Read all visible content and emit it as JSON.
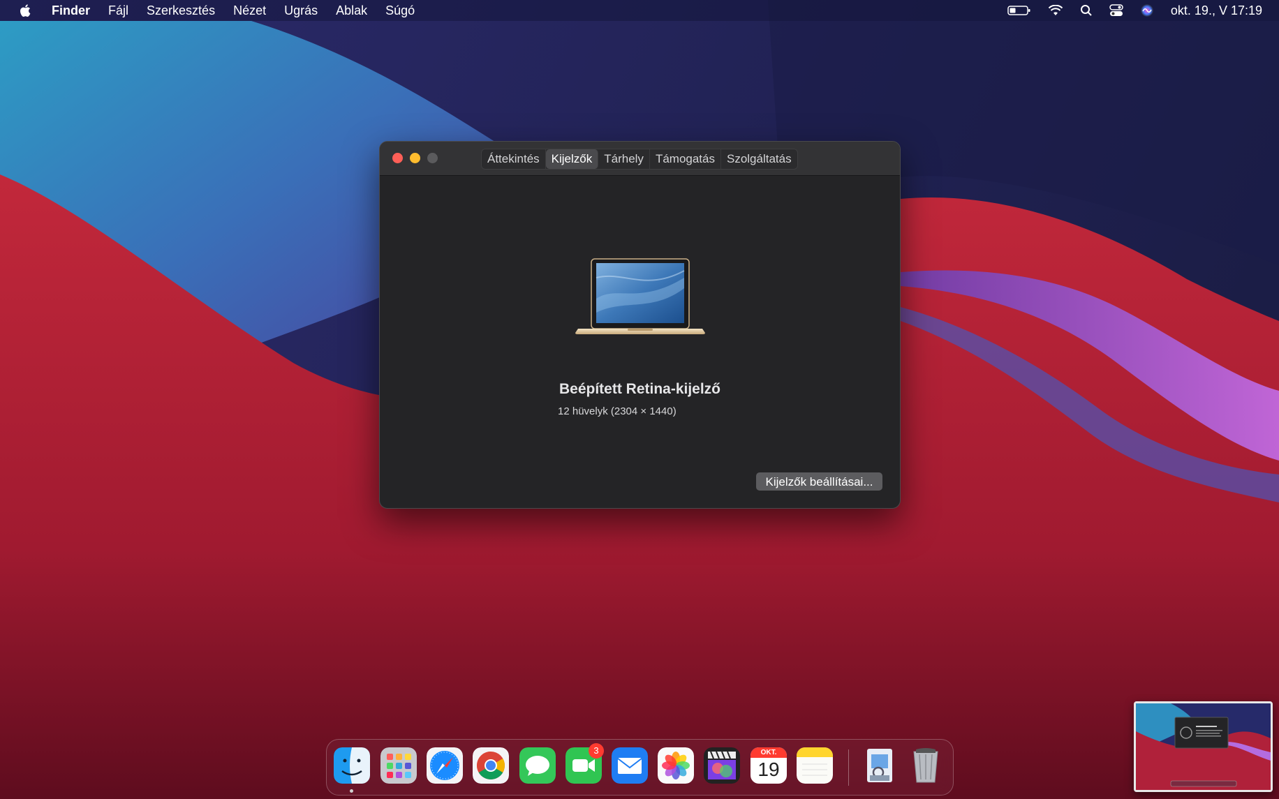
{
  "menubar": {
    "app_name": "Finder",
    "items": [
      "Fájl",
      "Szerkesztés",
      "Nézet",
      "Ugrás",
      "Ablak",
      "Súgó"
    ],
    "clock": "okt. 19., V  17:19"
  },
  "window": {
    "tabs": [
      "Áttekintés",
      "Kijelzők",
      "Tárhely",
      "Támogatás",
      "Szolgáltatás"
    ],
    "active_tab": "Kijelzők",
    "display_name": "Beépített Retina-kijelző",
    "display_spec": "12 hüvelyk (2304 × 1440)",
    "settings_button": "Kijelzők beállításai..."
  },
  "dock": {
    "apps": [
      "finder",
      "launchpad",
      "safari",
      "chrome",
      "messages",
      "facetime",
      "mail",
      "photos",
      "final-cut",
      "calendar",
      "notes",
      "preview",
      "trash"
    ],
    "facetime_badge": "3",
    "calendar_month": "OKT.",
    "calendar_day": "19"
  },
  "colors": {
    "accent_red": "#fe5f57",
    "accent_yellow": "#febc2e",
    "window_bg": "#242426"
  }
}
